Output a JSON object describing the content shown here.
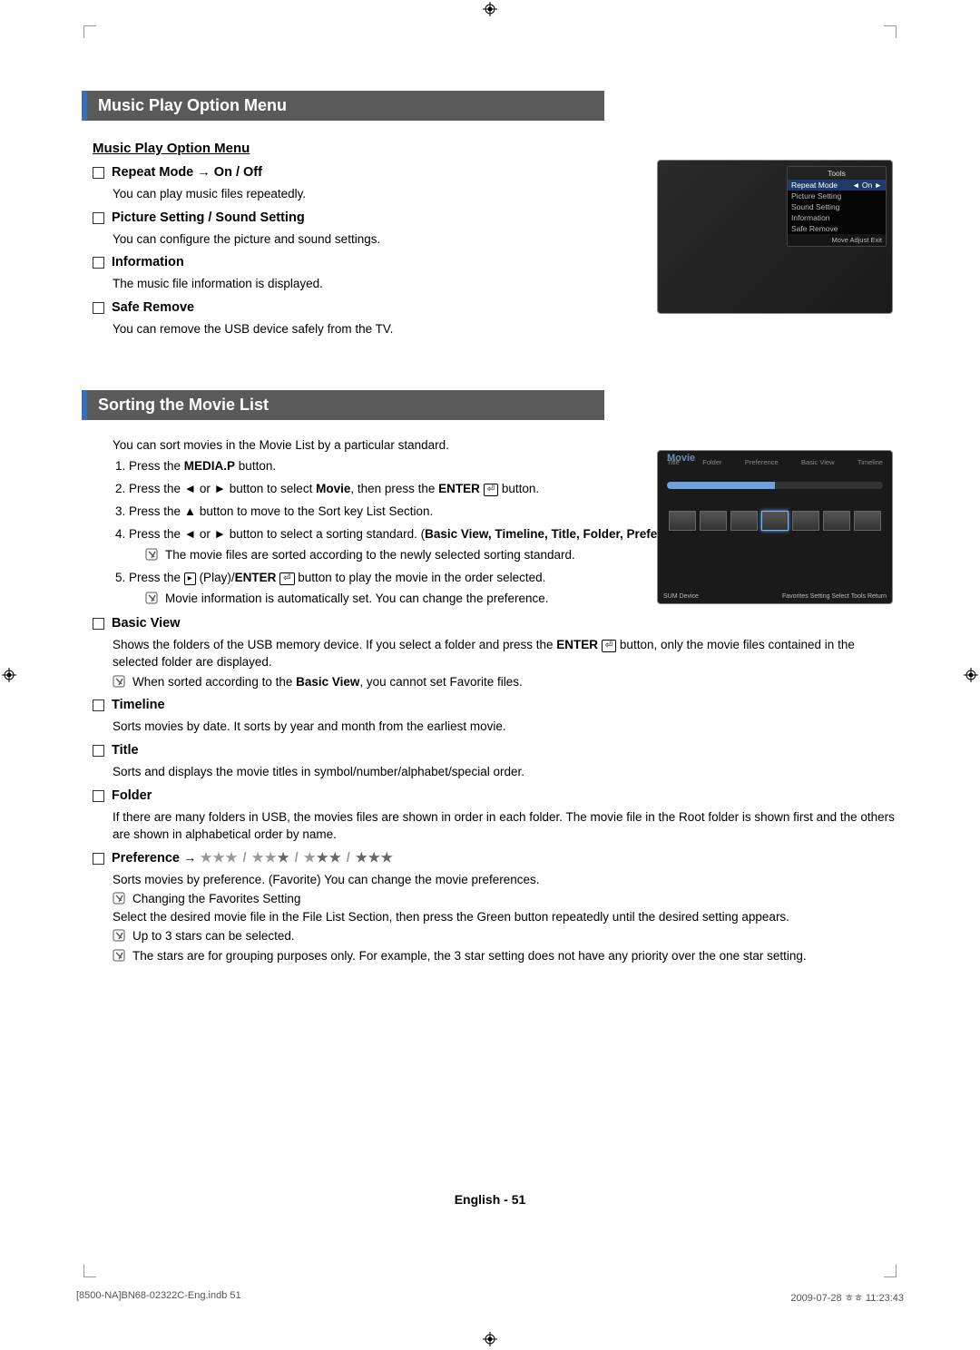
{
  "crop_label": "crop-mark",
  "section1": {
    "header": "Music Play Option Menu",
    "subhead": "Music Play Option Menu",
    "items": [
      {
        "title": "Repeat Mode → On / Off",
        "body": "You can play music files repeatedly."
      },
      {
        "title": "Picture Setting / Sound Setting",
        "body": "You can configure the picture and sound settings."
      },
      {
        "title": "Information",
        "body": "The music file information is displayed."
      },
      {
        "title": "Safe Remove",
        "body": "You can remove the USB device safely from the TV."
      }
    ]
  },
  "tools_panel": {
    "head": "Tools",
    "rows": [
      {
        "label": "Repeat Mode",
        "value": "On",
        "hl": true
      },
      {
        "label": "Picture Setting",
        "value": ""
      },
      {
        "label": "Sound Setting",
        "value": ""
      },
      {
        "label": "Information",
        "value": ""
      },
      {
        "label": "Safe Remove",
        "value": ""
      }
    ],
    "foot": "Move   Adjust   Exit"
  },
  "movie_box": {
    "title": "Movie",
    "tabs": [
      "Title",
      "Folder",
      "Preference",
      "Basic View",
      "Timeline"
    ],
    "foot_left": "SUM    Device",
    "foot_right": "Favorites Setting   Select   Tools   Return"
  },
  "section2": {
    "header": "Sorting the Movie List",
    "intro": "You can sort movies in the Movie List by a particular standard.",
    "steps": [
      {
        "plain_pre": "Press the ",
        "bold": "MEDIA.P",
        "plain_post": " button."
      },
      {
        "full_html": "Press the ◄ or ► button to select <b>Movie</b>, then press the <b>ENTER</b> <span class='enter-icon'>⏎</span> button."
      },
      {
        "full_html": "Press the ▲ button to move to the Sort key List Section."
      },
      {
        "full_html": "Press the ◄ or ► button to select a sorting standard. (<b>Basic View, Timeline, Title, Folder, Preference</b>)",
        "note": "The movie files are sorted according to the newly selected sorting standard."
      },
      {
        "full_html": "Press the <span class='play-icon'>▸</span> (Play)/<b>ENTER</b> <span class='enter-icon'>⏎</span> button to play the movie in the order selected.",
        "note": "Movie information is automatically set. You can change the preference."
      }
    ],
    "subs": {
      "basic_view": {
        "title": "Basic View",
        "body": "Shows the folders of the USB memory device. If you select a folder and press the ENTER ⏎ button, only the movie files contained in the selected folder are displayed.",
        "note": "When sorted according to the Basic View, you cannot set Favorite files."
      },
      "timeline": {
        "title": "Timeline",
        "body": "Sorts movies by date. It sorts by year and month from the earliest movie."
      },
      "title": {
        "title": "Title",
        "body": "Sorts and displays the movie titles in symbol/number/alphabet/special order."
      },
      "folder": {
        "title": "Folder",
        "body": "If there are many folders in USB, the movies files are shown in order in each folder. The movie file in the Root folder is shown first and the others are shown in alphabetical order by name."
      },
      "preference": {
        "title_prefix": "Preference → ",
        "stars_text": "★★★ / ★★★ / ★★★ / ★★★",
        "body": "Sorts movies by preference. (Favorite) You can change the movie preferences.",
        "notes": [
          "Changing the Favorites Setting",
          "Select the desired movie file in the File List Section, then press the Green button repeatedly until the desired setting appears.",
          "Up to 3 stars can be selected.",
          "The stars are for grouping purposes only. For example, the 3 star setting does not have any priority over the one star setting."
        ]
      }
    }
  },
  "footer_center": "English - 51",
  "print_foot": {
    "left": "[8500-NA]BN68-02322C-Eng.indb   51",
    "right": "2009-07-28   ㅎㅎ 11:23:43"
  }
}
